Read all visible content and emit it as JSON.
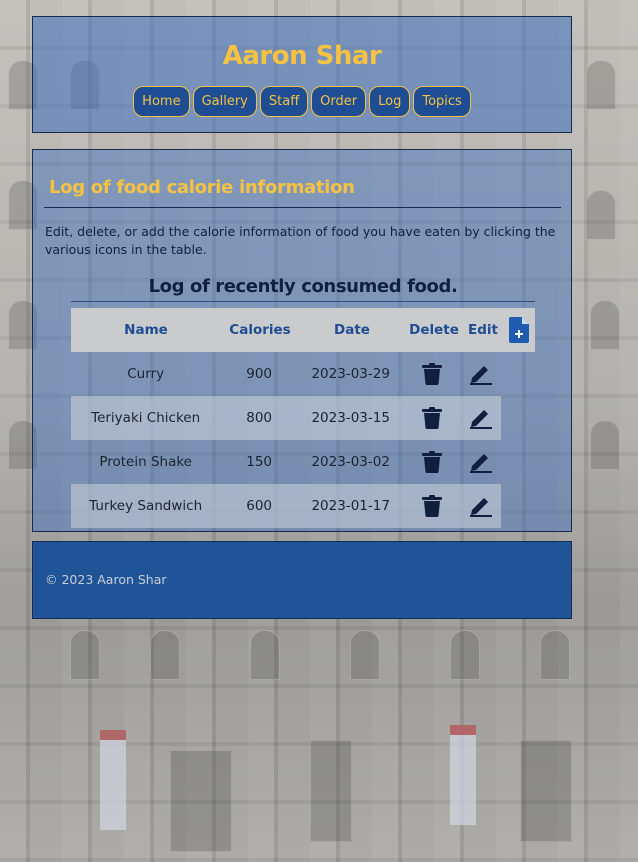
{
  "site": {
    "title": "Aaron Shar"
  },
  "nav": {
    "items": [
      {
        "label": "Home"
      },
      {
        "label": "Gallery"
      },
      {
        "label": "Staff"
      },
      {
        "label": "Order"
      },
      {
        "label": "Log"
      },
      {
        "label": "Topics"
      }
    ]
  },
  "main": {
    "heading": "Log of food calorie information",
    "intro": "Edit, delete, or add the calorie information of food you have eaten by clicking the various icons in the table.",
    "table": {
      "title": "Log of recently consumed food.",
      "headers": {
        "name": "Name",
        "calories": "Calories",
        "date": "Date",
        "delete": "Delete",
        "edit": "Edit"
      },
      "add_icon": "add-file-icon",
      "rows": [
        {
          "name": "Curry",
          "calories": "900",
          "date": "2023-03-29"
        },
        {
          "name": "Teriyaki Chicken",
          "calories": "800",
          "date": "2023-03-15"
        },
        {
          "name": "Protein Shake",
          "calories": "150",
          "date": "2023-03-02"
        },
        {
          "name": "Turkey Sandwich",
          "calories": "600",
          "date": "2023-01-17"
        }
      ]
    }
  },
  "footer": {
    "text": "© 2023 Aaron Shar"
  },
  "colors": {
    "accent": "#f5c242",
    "primary": "#1f4d93",
    "dark": "#10203f"
  }
}
